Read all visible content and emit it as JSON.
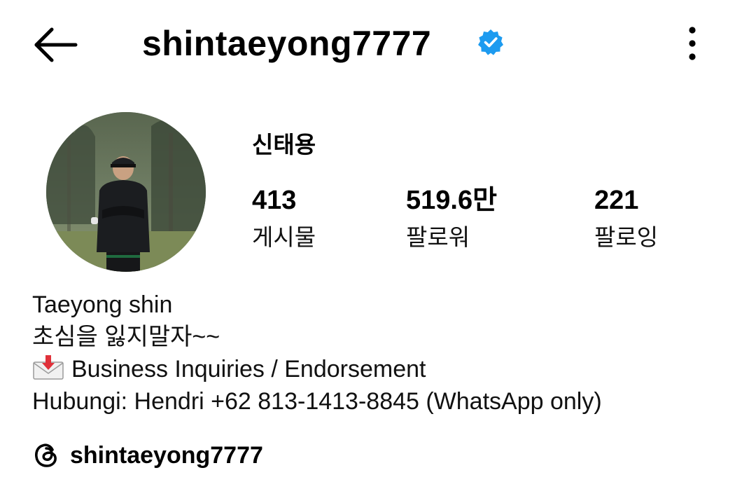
{
  "header": {
    "username": "shintaeyong7777",
    "back_icon": "arrow-left-icon",
    "verified_icon": "verified-badge-icon",
    "more_icon": "more-vertical-icon",
    "verified_color": "#1d9bf0"
  },
  "profile": {
    "display_name": "신태용",
    "stats": {
      "posts": {
        "value": "413",
        "label": "게시물"
      },
      "followers": {
        "value": "519.6만",
        "label": "팔로워"
      },
      "following": {
        "value": "221",
        "label": "팔로잉"
      }
    }
  },
  "bio": {
    "name_line": "Taeyong shin",
    "motto": "초심을 잃지말자~~",
    "business_emoji": "envelope-with-arrow-icon",
    "business_line": "Business Inquiries / Endorsement",
    "contact_line": "Hubungi: Hendri +62 813-1413-8845 (WhatsApp only)"
  },
  "threads": {
    "icon": "threads-icon",
    "handle": "shintaeyong7777"
  }
}
